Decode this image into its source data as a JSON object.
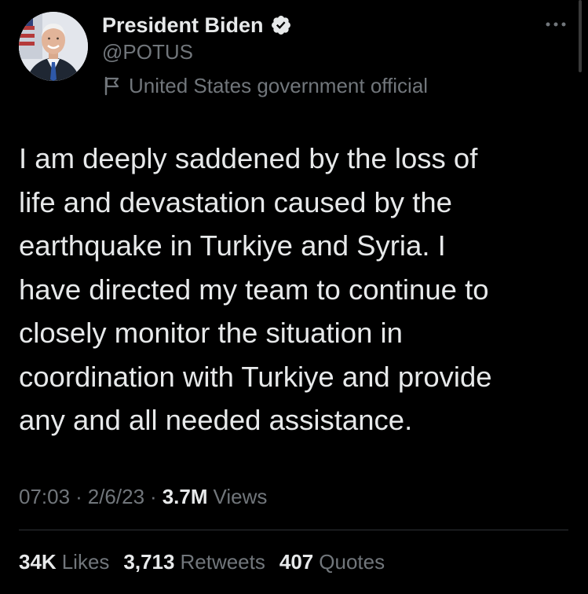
{
  "author": {
    "display_name": "President Biden",
    "handle": "@POTUS",
    "verified": true,
    "affiliation_label": "United States government official",
    "avatar_icon": "person-portrait-icon",
    "badge_icon": "verified-badge-icon"
  },
  "tweet": {
    "text": "I am deeply saddened by the loss of\nlife and devastation caused by the\nearthquake in Turkiye and Syria. I\nhave directed my team to continue to\nclosely monitor the situation in\ncoordination with Turkiye and provide\nany and all needed assistance."
  },
  "meta": {
    "time": "07:03",
    "separator": "·",
    "date": "2/6/23",
    "views_count": "3.7M",
    "views_label": "Views"
  },
  "stats": {
    "likes_count": "34K",
    "likes_label": "Likes",
    "retweets_count": "3,713",
    "retweets_label": "Retweets",
    "quotes_count": "407",
    "quotes_label": "Quotes"
  },
  "colors": {
    "background": "#000000",
    "primary_text": "#e7e9ea",
    "secondary_text": "#71767b",
    "verified_blue": "#1d9bf0",
    "divider": "#2f3336"
  }
}
